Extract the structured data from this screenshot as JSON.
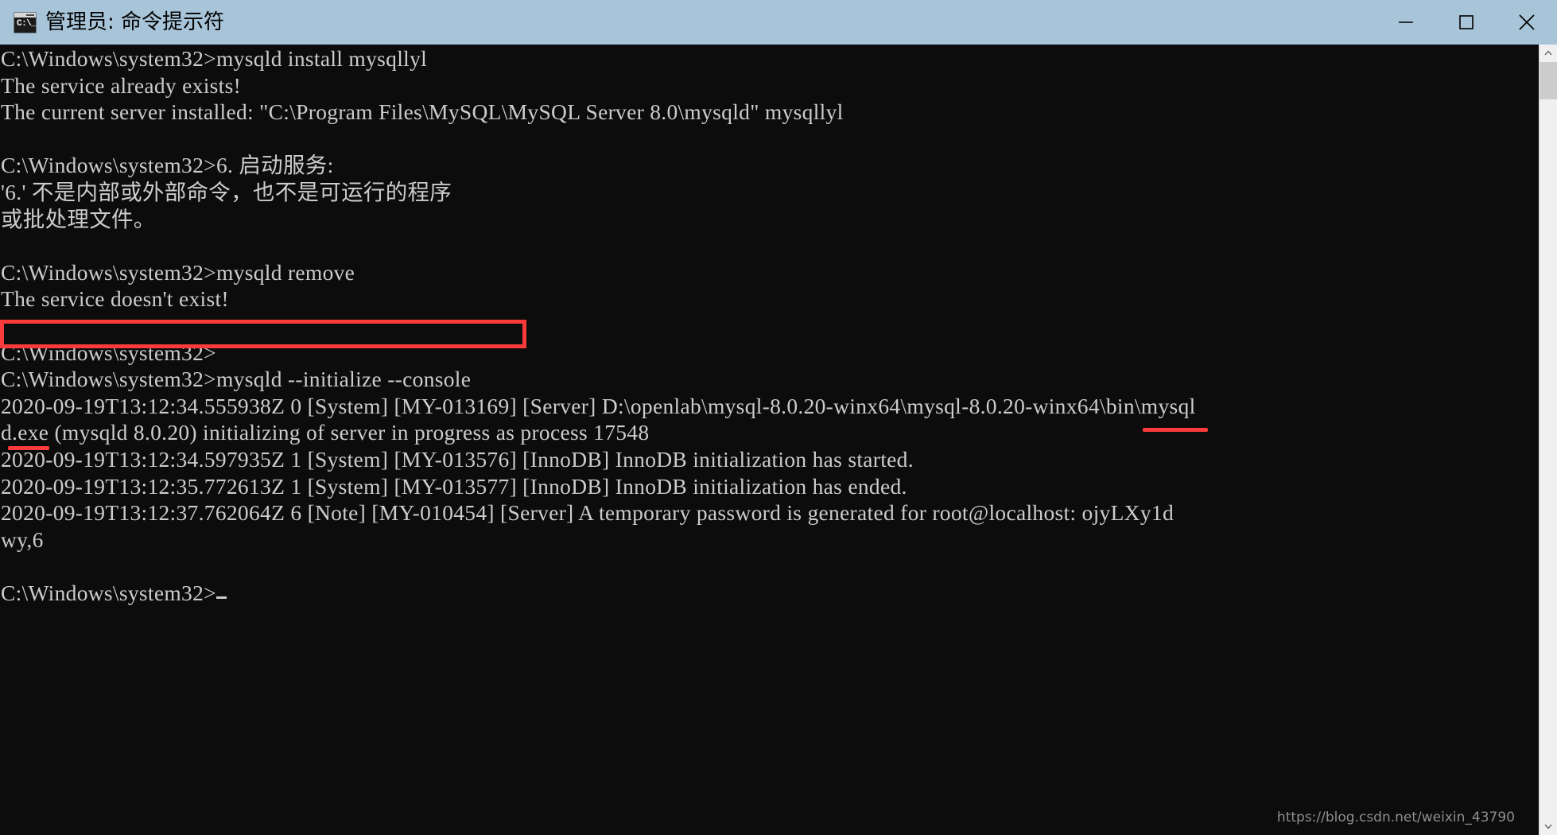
{
  "window": {
    "title": "管理员: 命令提示符",
    "icon_name": "cmd-icon",
    "icon_glyph": "C:\\_",
    "titlebar_color": "#a8c4d8",
    "console_bg": "#0c0c0c",
    "console_fg": "#cccccc",
    "annotation_color": "#fb3b3b",
    "buttons": {
      "minimize": "Minimize",
      "maximize": "Maximize",
      "close": "Close"
    }
  },
  "console": {
    "lines": [
      "C:\\Windows\\system32>mysqld install mysqllyl",
      "The service already exists!",
      "The current server installed: \"C:\\Program Files\\MySQL\\MySQL Server 8.0\\mysqld\" mysqllyl",
      "",
      "C:\\Windows\\system32>6. 启动服务:",
      "'6.' 不是内部或外部命令，也不是可运行的程序",
      "或批处理文件。",
      "",
      "C:\\Windows\\system32>mysqld remove",
      "The service doesn't exist!",
      "",
      "C:\\Windows\\system32>",
      "C:\\Windows\\system32>mysqld --initialize --console",
      "2020-09-19T13:12:34.555938Z 0 [System] [MY-013169] [Server] D:\\openlab\\mysql-8.0.20-winx64\\mysql-8.0.20-winx64\\bin\\mysql",
      "d.exe (mysqld 8.0.20) initializing of server in progress as process 17548",
      "2020-09-19T13:12:34.597935Z 1 [System] [MY-013576] [InnoDB] InnoDB initialization has started.",
      "2020-09-19T13:12:35.772613Z 1 [System] [MY-013577] [InnoDB] InnoDB initialization has ended.",
      "2020-09-19T13:12:37.762064Z 6 [Note] [MY-010454] [Server] A temporary password is generated for root@localhost: ojyLXy1d",
      "wy,6",
      "",
      "C:\\Windows\\system32>"
    ],
    "cursor_line_index": 20
  },
  "annotations": {
    "command_box_label": "mysqld --initialize --console",
    "password_underline_label": "ojyLXy1d",
    "password_wrap_underline_label": "wy,6"
  },
  "scrollbar": {
    "up_arrow": "▲",
    "down_arrow": "▼"
  },
  "watermark": {
    "text": "https://blog.csdn.net/weixin_43790"
  }
}
